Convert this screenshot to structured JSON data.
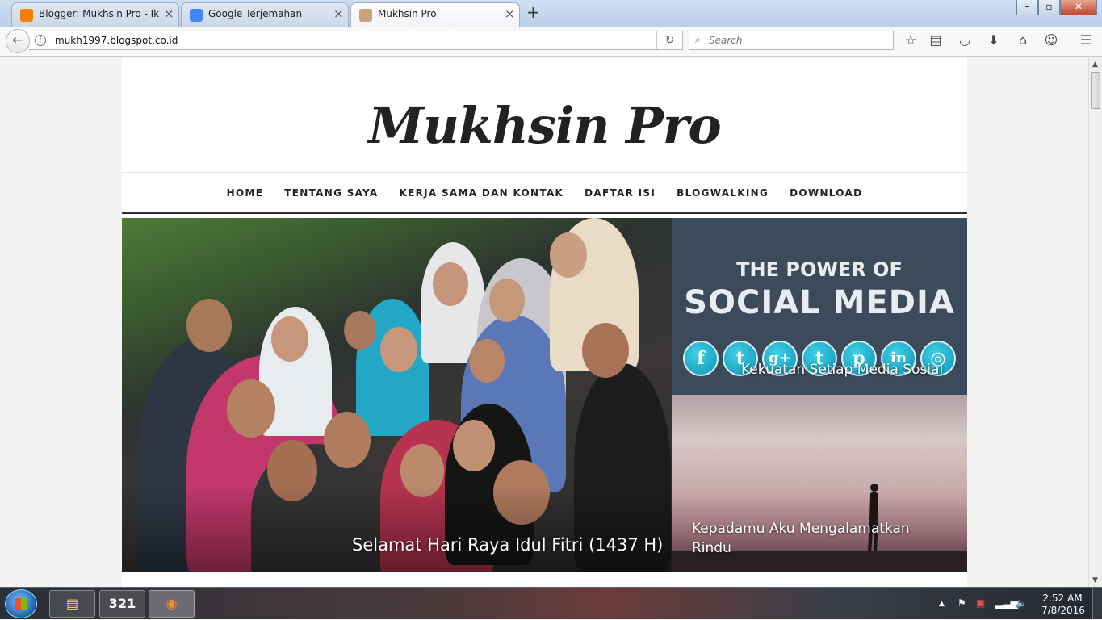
{
  "browser": {
    "tabs": [
      {
        "title": "Blogger: Mukhsin Pro - Ikh...",
        "favicon": "blogger-icon",
        "active": false
      },
      {
        "title": "Google Terjemahan",
        "favicon": "google-translate-icon",
        "active": false
      },
      {
        "title": "Mukhsin Pro",
        "favicon": "site-avatar-icon",
        "active": true
      }
    ],
    "new_tab_label": "+",
    "close_label": "×",
    "url": "mukh1997.blogspot.co.id",
    "search_placeholder": "Search",
    "window_buttons": {
      "minimize": "–",
      "maximize": "▫",
      "close": "✕"
    }
  },
  "blog": {
    "title": "Mukhsin Pro",
    "menu": [
      "HOME",
      "TENTANG SAYA",
      "KERJA SAMA DAN KONTAK",
      "DAFTAR ISI",
      "BLOGWALKING",
      "DOWNLOAD"
    ],
    "featured": [
      {
        "caption": "Selamat Hari Raya Idul Fitri (1437 H)"
      },
      {
        "caption": "Kekuatan Setiap Media Sosial",
        "image_text_top": "THE POWER OF",
        "image_text_bottom": "SOCIAL MEDIA",
        "icons": [
          "f",
          "t",
          "g+",
          "t",
          "p",
          "in",
          "◎"
        ]
      },
      {
        "caption": "Kepadamu Aku Mengalamatkan Rindu"
      }
    ]
  },
  "taskbar": {
    "apps": [
      "▤",
      "321",
      "◉"
    ],
    "clock_time": "2:52 AM",
    "clock_date": "7/8/2016"
  },
  "colors": {
    "accent_social": "#1aa9c7",
    "menu_border": "#333333",
    "win_close": "#c3452f"
  }
}
